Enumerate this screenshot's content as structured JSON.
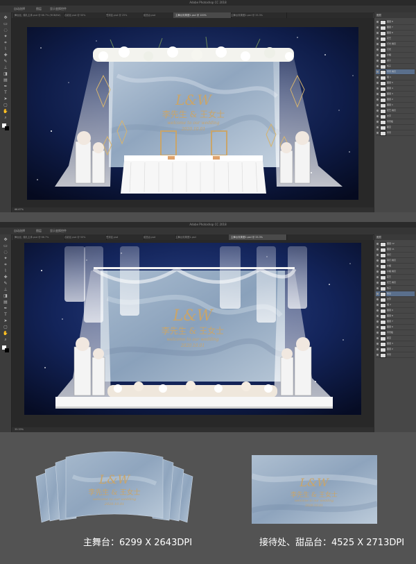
{
  "window_title": "Adobe Photoshop CC 2018",
  "options_bar": [
    "自动选择",
    "图层",
    "显示变换控件"
  ],
  "tabs_top": [
    {
      "label": "舞台区, 婚礼主体.psd @ 66.7% (RGB/8#)",
      "active": false
    },
    {
      "label": "合影区.psd @ 50%",
      "active": false
    },
    {
      "label": "签到区.psd @ 25%",
      "active": false
    },
    {
      "label": "甜品台.psd",
      "active": false
    },
    {
      "label": "主舞台效果图1.psd @ 100%",
      "active": true
    },
    {
      "label": "主舞台效果图2.psd @ 33.3%",
      "active": false
    }
  ],
  "tabs_bottom": [
    {
      "label": "舞台区, 婚礼主体.psd @ 66.7%",
      "active": false
    },
    {
      "label": "合影区.psd @ 50%",
      "active": false
    },
    {
      "label": "签到区.psd",
      "active": false
    },
    {
      "label": "甜品台.psd",
      "active": false
    },
    {
      "label": "主舞台效果图1.psd",
      "active": false
    },
    {
      "label": "主舞台效果图2.psd @ 33.3%",
      "active": true
    }
  ],
  "status_top": "66.67%",
  "status_bottom": "33.33%",
  "panel_title": "图层",
  "layers_top": [
    "图层 8",
    "图层 7",
    "图层 6",
    "花艺",
    "灯光 拷贝",
    "灯光",
    "纱幔",
    "桌子",
    "椅子",
    "背景 拷贝",
    "组 1",
    "图层 5",
    "图层 4",
    "图层 3",
    "图层 2",
    "图层 1",
    "花艺 拷贝",
    "文字",
    "背景板",
    "星空",
    "背景"
  ],
  "layers_bottom": [
    "图层 12",
    "图层 11",
    "吊灯",
    "吊灯 拷贝",
    "纱幔",
    "纱幔 拷贝",
    "花艺",
    "花艺 拷贝",
    "柱子",
    "舞台",
    "文字",
    "组 2",
    "图层 9",
    "图层 8",
    "图层 7",
    "图层 6",
    "背景板",
    "星空",
    "图层 3",
    "图层 2",
    "背景"
  ],
  "monogram": "L&W",
  "names": "李先生 & 王女士",
  "welcome": "welcome to our wedding",
  "date": "2020.10.01",
  "label_main_stage": "主舞台：6299 X 2643DPI",
  "label_dessert": "接待处、甜品台：4525 X 2713DPI",
  "colors": {
    "gold": "#c9a56a",
    "night_sky": "#0d1a3d",
    "marble": "#9fb2c8",
    "ps_dark": "#3a3a3a"
  }
}
